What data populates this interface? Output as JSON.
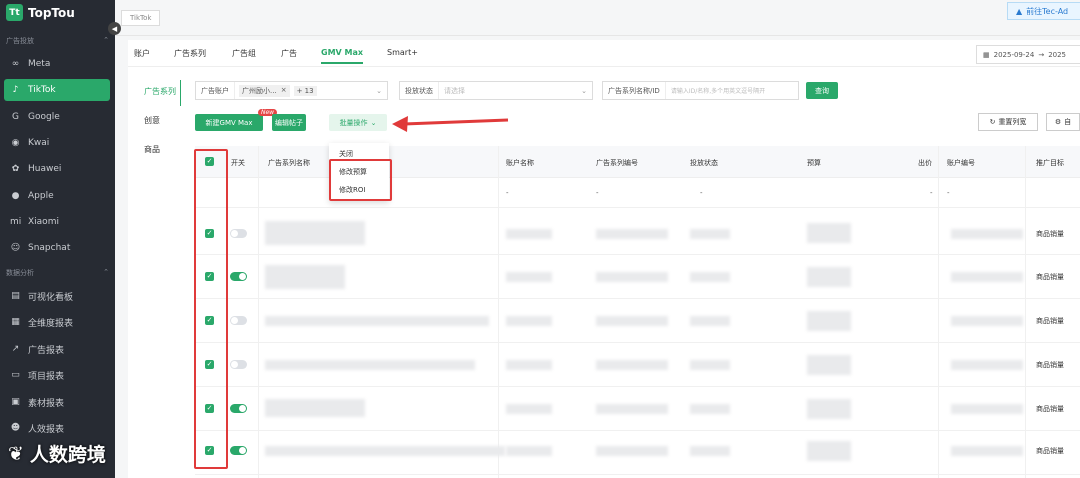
{
  "sidebar": {
    "brand": "TopTou",
    "section1": "广告投放",
    "section2": "数据分析",
    "items": [
      {
        "label": "Meta",
        "icon": "meta-icon"
      },
      {
        "label": "TikTok",
        "icon": "tiktok-icon"
      },
      {
        "label": "Google",
        "icon": "google-icon"
      },
      {
        "label": "Kwai",
        "icon": "kwai-icon"
      },
      {
        "label": "Huawei",
        "icon": "huawei-icon"
      },
      {
        "label": "Apple",
        "icon": "apple-icon"
      },
      {
        "label": "Xiaomi",
        "icon": "xiaomi-icon"
      },
      {
        "label": "Snapchat",
        "icon": "snapchat-icon"
      }
    ],
    "reports": [
      {
        "label": "可视化看板"
      },
      {
        "label": "全维度报表"
      },
      {
        "label": "广告报表"
      },
      {
        "label": "项目报表"
      },
      {
        "label": "素材报表"
      },
      {
        "label": "人效报表"
      }
    ]
  },
  "top": {
    "tab": "TikTok",
    "tec": "前往Tec-Ad"
  },
  "subtabs": [
    "账户",
    "广告系列",
    "广告组",
    "广告",
    "GMV Max",
    "Smart+"
  ],
  "date": {
    "from": "2025-09-24",
    "to": "2025"
  },
  "leftnav": [
    "广告系列",
    "创意",
    "商品"
  ],
  "filters": {
    "account_label": "广告账户",
    "account_chip": "广州励小...",
    "more": "+ 13",
    "status_label": "投放状态",
    "status_ph": "请选择",
    "name_label": "广告系列名称/ID",
    "name_ph": "请输入ID/名称,多个用英文逗号隔开",
    "query": "查询"
  },
  "actions": {
    "new": "新建GMV Max",
    "new_badge": "New",
    "edit": "编辑帖子",
    "batch": "批量操作",
    "reset": "重置列宽",
    "custom": "自"
  },
  "menu": [
    "关闭",
    "修改预算",
    "修改ROI"
  ],
  "table": {
    "headers": [
      "开关",
      "广告系列名称",
      "账户名称",
      "广告系列编号",
      "投放状态",
      "预算",
      "出价",
      "账户编号",
      "推广目标"
    ],
    "dash": "-",
    "goal": "商品销量",
    "toggles": [
      false,
      true,
      false,
      false,
      true,
      true
    ]
  },
  "watermark": "人数跨境"
}
